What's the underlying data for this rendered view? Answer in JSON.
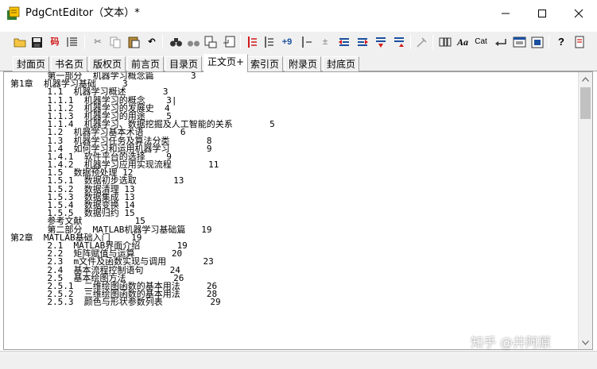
{
  "window": {
    "title": "PdgCntEditor（文本）*"
  },
  "toolbar": {
    "items": [
      {
        "icon": "open-folder-icon",
        "glyph": ""
      },
      {
        "icon": "save-icon",
        "glyph": ""
      },
      {
        "icon": "code-icon",
        "glyph": "码"
      },
      {
        "icon": "list-icon",
        "glyph": ""
      },
      {
        "icon": "cut-icon",
        "glyph": "✂"
      },
      {
        "icon": "copy-icon",
        "glyph": ""
      },
      {
        "icon": "paste-icon",
        "glyph": ""
      },
      {
        "icon": "undo-icon",
        "glyph": "↶"
      },
      {
        "icon": "find-icon",
        "glyph": ""
      },
      {
        "icon": "find-next-icon",
        "glyph": ""
      },
      {
        "icon": "replace-icon",
        "glyph": ""
      },
      {
        "icon": "replace-next-icon",
        "glyph": ""
      },
      {
        "icon": "align-left-icon",
        "glyph": ""
      },
      {
        "icon": "indent-icon",
        "glyph": ""
      },
      {
        "icon": "page-number-icon",
        "glyph": "+9"
      },
      {
        "icon": "page-shift-icon",
        "glyph": ""
      },
      {
        "icon": "plus-minus-icon",
        "glyph": "±"
      },
      {
        "icon": "move-left-icon",
        "glyph": ""
      },
      {
        "icon": "move-right-icon",
        "glyph": ""
      },
      {
        "icon": "move-down-icon",
        "glyph": ""
      },
      {
        "icon": "move-up-icon",
        "glyph": ""
      },
      {
        "icon": "tools-icon",
        "glyph": ""
      },
      {
        "icon": "columns-icon",
        "glyph": ""
      },
      {
        "icon": "font-icon",
        "glyph": "Aa"
      },
      {
        "icon": "catalog-icon",
        "glyph": "Cat"
      },
      {
        "icon": "arrow-icon",
        "glyph": ""
      },
      {
        "icon": "window-icon",
        "glyph": ""
      },
      {
        "icon": "export-icon",
        "glyph": ""
      },
      {
        "icon": "help-icon",
        "glyph": "?"
      },
      {
        "icon": "settings-icon",
        "glyph": ""
      }
    ]
  },
  "tabs": [
    {
      "label": "封面页"
    },
    {
      "label": "书名页"
    },
    {
      "label": "版权页"
    },
    {
      "label": "前言页"
    },
    {
      "label": "目录页"
    },
    {
      "label": "正文页+"
    },
    {
      "label": "索引页"
    },
    {
      "label": "附录页"
    },
    {
      "label": "封底页"
    }
  ],
  "active_tab": "正文页+",
  "editor": {
    "lines": [
      "       第一部分  机器学习概念篇       3",
      "第1章  机器学习基础     3",
      "       1.1  机器学习概述       3",
      "       1.1.1  机器学习的概念    3|",
      "       1.1.2  机器学习的发展史  4",
      "       1.1.3  机器学习的用途    5",
      "       1.1.4  机器学习、数据挖掘及人工智能的关系       5",
      "       1.2  机器学习基本术语       6",
      "       1.3  机器学习任务及算法分类       8",
      "       1.4  如何学习和运用机器学习       9",
      "       1.4.1  软件平台的选择    9",
      "       1.4.2  机器学习应用实现流程       11",
      "       1.5  数据预处理 12",
      "       1.5.1  数据初步选取       13",
      "       1.5.2  数据清理 13",
      "       1.5.3  数据集成 13",
      "       1.5.4  数据变换 14",
      "       1.5.5  数据归约 15",
      "       参考文献          15",
      "       第二部分  MATLAB机器学习基础篇   19",
      "第2章  MATLAB基础入门    19",
      "       2.1  MATLAB界面介绍       19",
      "       2.2  矩阵赋值与运算       20",
      "       2.3  m文件及函数实现与调用       23",
      "       2.4  基本流程控制语句     24",
      "       2.5  基本绘图方法         26",
      "       2.5.1  二维绘图函数的基本用法     26",
      "       2.5.2  三维绘图函数的基本用法     28",
      "       2.5.3  颜色与形状参数列表         29"
    ]
  },
  "watermark": "知乎 @井阿原",
  "colors": {
    "accent_red": "#d11a1a",
    "icon_blue": "#1a4fa0",
    "scroll_thumb": "#c1c1c1"
  }
}
